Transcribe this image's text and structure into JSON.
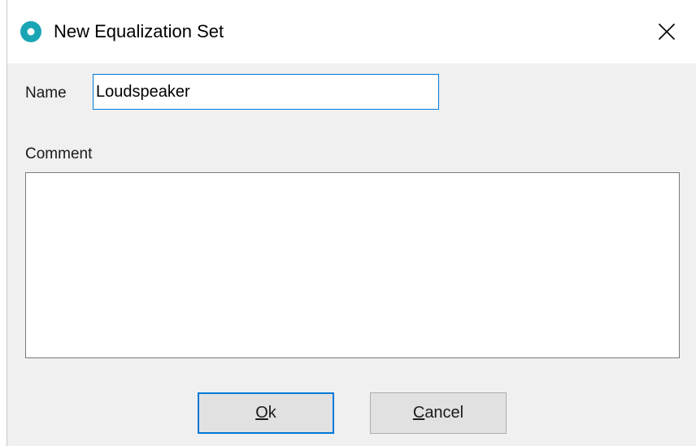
{
  "window": {
    "title": "New Equalization Set",
    "icon": "app-logo-icon",
    "close_icon": "close-icon",
    "accent_color": "#0078d7",
    "icon_color": "#1aa5b4"
  },
  "form": {
    "name_label": "Name",
    "name_value": "Loudspeaker",
    "comment_label": "Comment",
    "comment_value": ""
  },
  "buttons": {
    "ok": {
      "mnemonic": "O",
      "rest": "k"
    },
    "cancel": {
      "mnemonic": "C",
      "rest": "ancel"
    }
  }
}
